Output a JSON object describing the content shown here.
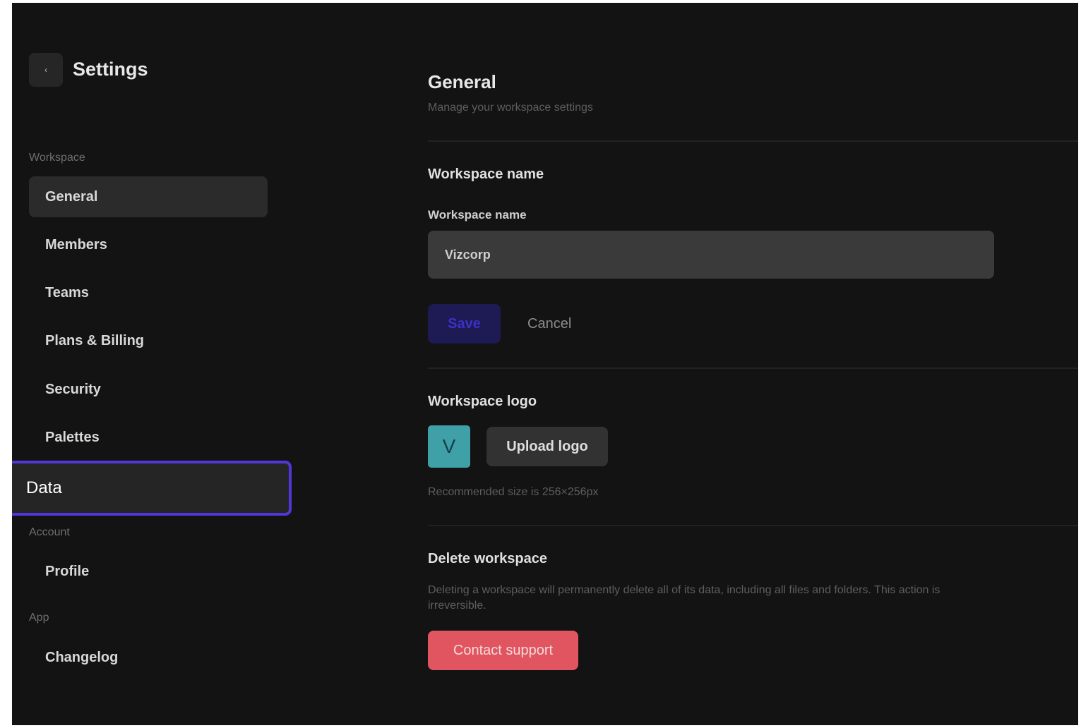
{
  "sidebar": {
    "title": "Settings",
    "back_icon": "chevron-left-icon",
    "sections": {
      "workspace": "Workspace",
      "account": "Account",
      "app": "App"
    },
    "items": {
      "general": "General",
      "members": "Members",
      "teams": "Teams",
      "plans_billing": "Plans & Billing",
      "security": "Security",
      "palettes": "Palettes",
      "data": "Data",
      "profile": "Profile",
      "changelog": "Changelog"
    },
    "active_item": "General",
    "highlighted_item": "Data"
  },
  "main": {
    "title": "General",
    "subtitle": "Manage your workspace settings",
    "workspace_name": {
      "heading": "Workspace name",
      "label": "Workspace name",
      "value": "Vizcorp",
      "save_label": "Save",
      "cancel_label": "Cancel"
    },
    "workspace_logo": {
      "heading": "Workspace logo",
      "logo_letter": "V",
      "upload_label": "Upload logo",
      "hint": "Recommended size is 256×256px"
    },
    "delete_workspace": {
      "heading": "Delete workspace",
      "description": "Deleting a workspace will permanently delete all of its data, including all files and folders. This action is irreversible.",
      "contact_label": "Contact support"
    }
  },
  "colors": {
    "background": "#131313",
    "highlight_border": "#5236d9",
    "save_button": "#1d1a54",
    "logo_tile": "#3fa1a7",
    "danger": "#e05560"
  }
}
